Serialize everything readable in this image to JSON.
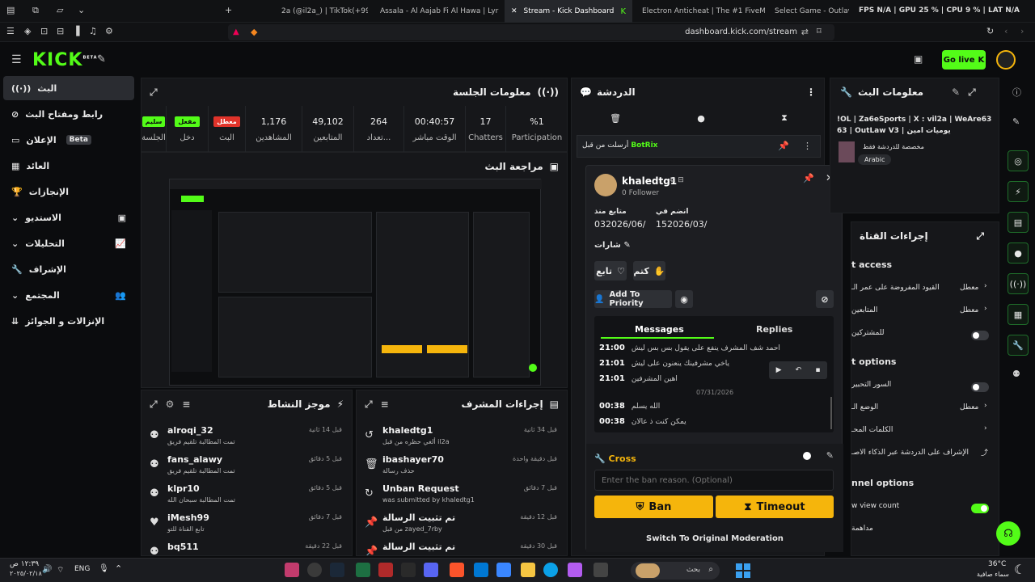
{
  "browser": {
    "tabs": [
      {
        "label": "2a (@il2a_) | TikTok(+99)"
      },
      {
        "label": "Assala - Al Aajab Fi Al Hawa | Lyri"
      },
      {
        "label": "Stream - Kick Dashboard"
      },
      {
        "label": "Electron Anticheat | The #1 FiveM An"
      },
      {
        "label": "Select Game - Outlaw"
      }
    ],
    "url": "dashboard.kick.com/stream",
    "fps_label": "FPS N/A | GPU 25 % | CPU 9 % | LAT N/A"
  },
  "header": {
    "logo": "KICK",
    "logo_beta": "BETA",
    "go_live": "Go live"
  },
  "sidebar": {
    "items": [
      {
        "label": "البث"
      },
      {
        "label": "رابط ومفتاح البث"
      },
      {
        "label": "الإعلان",
        "badge": "Beta"
      },
      {
        "label": "العائد"
      },
      {
        "label": "الإنجازات"
      },
      {
        "label": "الاستديو"
      },
      {
        "label": "التحليلات"
      },
      {
        "label": "الإشراف"
      },
      {
        "label": "المجتمع"
      },
      {
        "label": "الإنزالات و الجوائز"
      }
    ]
  },
  "session": {
    "title": "معلومات الجلسة",
    "stats": [
      {
        "value": "سليم",
        "label": "الجلسة",
        "pill_color": "#53fc18"
      },
      {
        "value": "مفعل",
        "label": "دخل",
        "pill_color": "#53fc18"
      },
      {
        "value": "معطل",
        "label": "البث",
        "pill_color": "#e0332a"
      },
      {
        "value": "1,176",
        "label": "المشاهدين"
      },
      {
        "value": "49,102",
        "label": "المتابعين"
      },
      {
        "value": "264",
        "label": "تعداد..."
      },
      {
        "value": "00:40:57",
        "label": "الوقت مباشر"
      },
      {
        "value": "17",
        "label": "Chatters"
      },
      {
        "value": "%1",
        "label": "Participation"
      }
    ]
  },
  "preview": {
    "title": "مراجعة البث"
  },
  "activity": {
    "title": "موجز النشاط",
    "rows": [
      {
        "name": "alroqi_32",
        "sub": "تمت المطالبة تلقيم فريق",
        "time": "قبل 14 ثانية",
        "icon": "reward-icon"
      },
      {
        "name": "fans_alawy",
        "sub": "تمت المطالبة تلقيم فريق",
        "time": "قبل 5 دقائق",
        "icon": "reward-icon"
      },
      {
        "name": "klpr10",
        "sub": "تمت المطالبة سبحان الله",
        "time": "قبل 5 دقائق",
        "icon": "reward-icon"
      },
      {
        "name": "iMesh99",
        "sub": "تابع القناة للتو",
        "time": "قبل 7 دقائق",
        "icon": "heart-icon"
      },
      {
        "name": "bq511",
        "sub": "",
        "time": "قبل 22 دقيقة",
        "icon": "reward-icon"
      }
    ]
  },
  "modactions": {
    "title": "إجراءات المشرف",
    "rows": [
      {
        "name": "khaledtg1",
        "sub": "ألغي حظره من قبل il2a",
        "time": "قبل 34 ثانية",
        "icon": "undo-icon"
      },
      {
        "name": "ibashayer70",
        "sub": "حذف رسالة",
        "time": "قبل دقيقة واحدة",
        "icon": "trash-icon"
      },
      {
        "name": "Unban Request",
        "sub": "was submitted by khaledtg1",
        "time": "قبل 7 دقائق",
        "icon": "unban-request-icon"
      },
      {
        "name": "تم تثبيت الرسالة",
        "sub": "من قبل zayed_7rby",
        "time": "قبل 12 دقيقة",
        "icon": "pin-icon"
      },
      {
        "name": "تم تثبيت الرسالة",
        "sub": "",
        "time": "قبل 30 دقيقة",
        "icon": "pin-icon"
      }
    ]
  },
  "chat": {
    "title": "الدردشة",
    "pinned_user": "BotRix",
    "pinned_label": "أرسلت من قبل"
  },
  "popup": {
    "username": "khaledtg1",
    "followers": "0 Follower",
    "follow_since_label": "متابع منذ",
    "follow_since": "032026/06/",
    "joined_label": "انضم في",
    "joined": "152026/03/",
    "badges_label": "شارات",
    "follow_btn": "تابع",
    "mute_btn": "كتم",
    "priority_btn": "Add To Priority",
    "tab_messages": "Messages",
    "tab_replies": "Replies",
    "messages": [
      {
        "time": "21:00",
        "text": "احمد شف المشرف ينفع على يقول بس بس ليش"
      },
      {
        "time": "21:01",
        "text": "ياخي مشرفينك ينعنون على ليش"
      },
      {
        "time": "21:01",
        "text": "اهين المشرفين"
      },
      {
        "time": "00:38",
        "text": "الله يسلم"
      },
      {
        "time": "00:38",
        "text": "يمكن كنت ذ عالان"
      }
    ],
    "date_divider": "07/31/2026",
    "cross_title": "Cross",
    "ban_reason_placeholder": "Enter the ban reason. (Optional)",
    "ban_btn": "Ban",
    "timeout_btn": "Timeout",
    "switch_mod": "Switch To Original Moderation"
  },
  "streaminfo": {
    "title": "معلومات البث",
    "stream_title_line1": "!OL | Za6eSports | X : vil2a | WeAre63",
    "stream_title_line2": "63 | OutLaw V3 | يوميات امين",
    "category": "مخصصة للدردشة فقط",
    "language": "Arabic"
  },
  "channelactions": {
    "title": "إجراءات القناة",
    "section1": "t access",
    "row1": "القيود المفروضة على عمر الـ",
    "row1_val": "معطل",
    "row2": "المتابعين",
    "row2_val": "معطل",
    "row3": "للمشتركين",
    "section2": "t options",
    "row4": "السور التحبير",
    "row5": "الوضع الـ",
    "row5_val": "معطل",
    "row6": "الكلمات المحـ",
    "row7": "الإشراف على الدردشة عبر الذكاء الاصـ",
    "section3": "nnel options",
    "row8": "w view count",
    "row9": "مداهمة"
  },
  "taskbar": {
    "time": "١٢:٣٩ ص",
    "date": "٢٠٢٥/٠٢/١٨",
    "lang": "ENG",
    "weather_temp": "36°C",
    "weather_desc": "سماء صافية",
    "search_placeholder": "بحث"
  }
}
